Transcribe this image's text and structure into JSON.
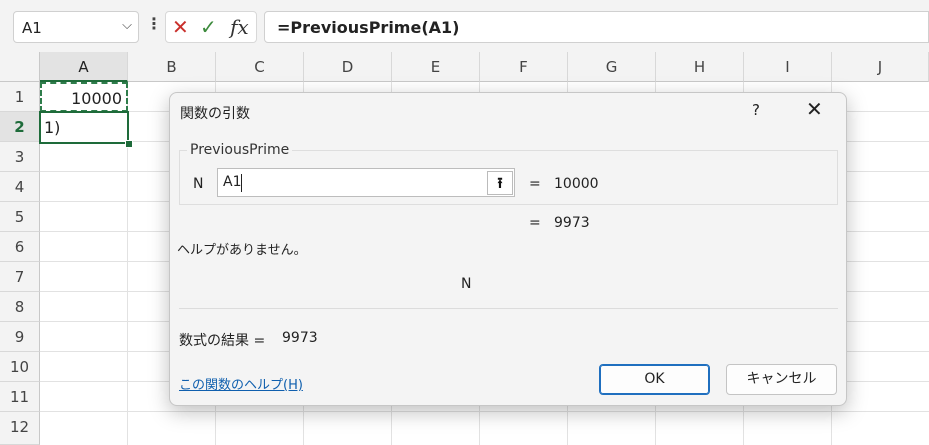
{
  "formula_bar": {
    "name_box": "A1",
    "cancel_glyph": "✕",
    "enter_glyph": "✓",
    "fx_label": "fx",
    "formula": "=PreviousPrime(A1)"
  },
  "columns": [
    "A",
    "B",
    "C",
    "D",
    "E",
    "F",
    "G",
    "H",
    "I",
    "J"
  ],
  "rows": [
    "1",
    "2",
    "3",
    "4",
    "5",
    "6",
    "7",
    "8",
    "9",
    "10",
    "11",
    "12"
  ],
  "cells": {
    "A1": "10000",
    "A2": "1)"
  },
  "dialog": {
    "title": "関数の引数",
    "help_glyph": "?",
    "close_glyph": "✕",
    "function_name": "PreviousPrime",
    "arg_label": "N",
    "arg_value": "A1",
    "arg_eq": "=",
    "arg_result": "10000",
    "result_eq": "=",
    "result_value": "9973",
    "description": "ヘルプがありません。",
    "arg_description": "N",
    "formula_result_label": "数式の結果 =",
    "formula_result_value": "9973",
    "help_link": "この関数のヘルプ(H)",
    "ok_label": "OK",
    "cancel_label": "キャンセル"
  },
  "icons": {
    "name_box_dropdown": "chevron-down-icon",
    "formula_bar_options": "vertical-dots-icon",
    "arg_collapse": "collapse-dialog-icon"
  },
  "colors": {
    "selection_green": "#1e6b3a",
    "link_blue": "#0f5fae",
    "ok_border": "#1f6fbf"
  }
}
